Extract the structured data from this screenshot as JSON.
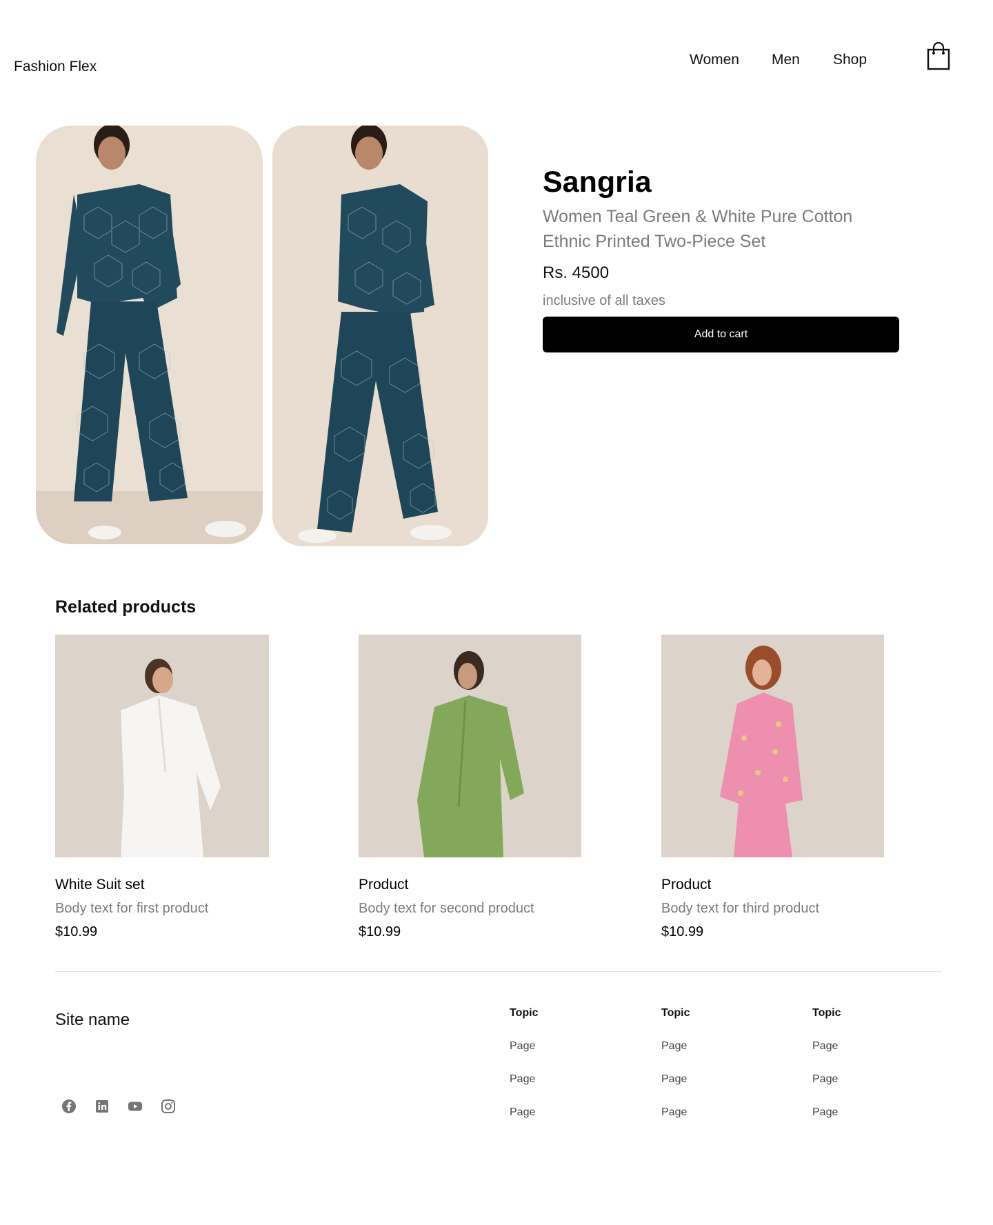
{
  "header": {
    "brand": "Fashion Flex",
    "nav": [
      "Women",
      "Men",
      "Shop"
    ],
    "cart_icon": "shopping-bag-icon"
  },
  "product": {
    "title": "Sangria",
    "subtitle": "Women Teal Green & White Pure Cotton Ethnic Printed Two-Piece Set",
    "price": "Rs. 4500",
    "tax_note": "inclusive of all taxes",
    "add_to_cart": "Add to cart"
  },
  "related": {
    "heading": "Related products",
    "items": [
      {
        "name": "White Suit set",
        "desc": "Body text for first product",
        "price": "$10.99"
      },
      {
        "name": "Product",
        "desc": "Body text for second product",
        "price": "$10.99"
      },
      {
        "name": "Product",
        "desc": "Body text for third product",
        "price": "$10.99"
      }
    ]
  },
  "footer": {
    "site_name": "Site name",
    "socials": [
      "facebook-icon",
      "linkedin-icon",
      "youtube-icon",
      "instagram-icon"
    ],
    "columns": [
      {
        "topic": "Topic",
        "pages": [
          "Page",
          "Page",
          "Page"
        ]
      },
      {
        "topic": "Topic",
        "pages": [
          "Page",
          "Page",
          "Page"
        ]
      },
      {
        "topic": "Topic",
        "pages": [
          "Page",
          "Page",
          "Page"
        ]
      }
    ]
  },
  "colors": {
    "accent": "#000000",
    "muted_text": "#7b7b7b",
    "product_bg": "#dcd3ca",
    "gallery_bg": "#eadfd3",
    "teal": "#214a5c"
  }
}
